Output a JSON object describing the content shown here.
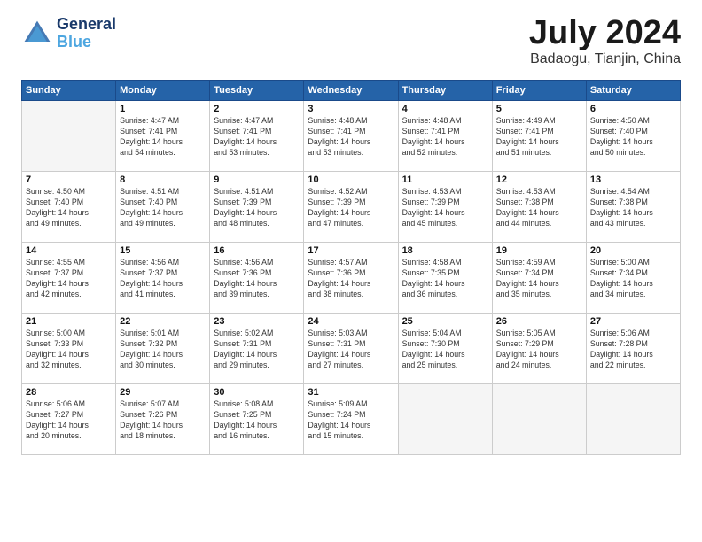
{
  "header": {
    "logo_line1": "General",
    "logo_line2": "Blue",
    "month": "July 2024",
    "location": "Badaogu, Tianjin, China"
  },
  "days": [
    "Sunday",
    "Monday",
    "Tuesday",
    "Wednesday",
    "Thursday",
    "Friday",
    "Saturday"
  ],
  "weeks": [
    [
      {
        "day": "",
        "sunrise": "",
        "sunset": "",
        "daylight": ""
      },
      {
        "day": "1",
        "sunrise": "Sunrise: 4:47 AM",
        "sunset": "Sunset: 7:41 PM",
        "daylight": "Daylight: 14 hours and 54 minutes."
      },
      {
        "day": "2",
        "sunrise": "Sunrise: 4:47 AM",
        "sunset": "Sunset: 7:41 PM",
        "daylight": "Daylight: 14 hours and 53 minutes."
      },
      {
        "day": "3",
        "sunrise": "Sunrise: 4:48 AM",
        "sunset": "Sunset: 7:41 PM",
        "daylight": "Daylight: 14 hours and 53 minutes."
      },
      {
        "day": "4",
        "sunrise": "Sunrise: 4:48 AM",
        "sunset": "Sunset: 7:41 PM",
        "daylight": "Daylight: 14 hours and 52 minutes."
      },
      {
        "day": "5",
        "sunrise": "Sunrise: 4:49 AM",
        "sunset": "Sunset: 7:41 PM",
        "daylight": "Daylight: 14 hours and 51 minutes."
      },
      {
        "day": "6",
        "sunrise": "Sunrise: 4:50 AM",
        "sunset": "Sunset: 7:40 PM",
        "daylight": "Daylight: 14 hours and 50 minutes."
      }
    ],
    [
      {
        "day": "7",
        "sunrise": "Sunrise: 4:50 AM",
        "sunset": "Sunset: 7:40 PM",
        "daylight": "Daylight: 14 hours and 49 minutes."
      },
      {
        "day": "8",
        "sunrise": "Sunrise: 4:51 AM",
        "sunset": "Sunset: 7:40 PM",
        "daylight": "Daylight: 14 hours and 49 minutes."
      },
      {
        "day": "9",
        "sunrise": "Sunrise: 4:51 AM",
        "sunset": "Sunset: 7:39 PM",
        "daylight": "Daylight: 14 hours and 48 minutes."
      },
      {
        "day": "10",
        "sunrise": "Sunrise: 4:52 AM",
        "sunset": "Sunset: 7:39 PM",
        "daylight": "Daylight: 14 hours and 47 minutes."
      },
      {
        "day": "11",
        "sunrise": "Sunrise: 4:53 AM",
        "sunset": "Sunset: 7:39 PM",
        "daylight": "Daylight: 14 hours and 45 minutes."
      },
      {
        "day": "12",
        "sunrise": "Sunrise: 4:53 AM",
        "sunset": "Sunset: 7:38 PM",
        "daylight": "Daylight: 14 hours and 44 minutes."
      },
      {
        "day": "13",
        "sunrise": "Sunrise: 4:54 AM",
        "sunset": "Sunset: 7:38 PM",
        "daylight": "Daylight: 14 hours and 43 minutes."
      }
    ],
    [
      {
        "day": "14",
        "sunrise": "Sunrise: 4:55 AM",
        "sunset": "Sunset: 7:37 PM",
        "daylight": "Daylight: 14 hours and 42 minutes."
      },
      {
        "day": "15",
        "sunrise": "Sunrise: 4:56 AM",
        "sunset": "Sunset: 7:37 PM",
        "daylight": "Daylight: 14 hours and 41 minutes."
      },
      {
        "day": "16",
        "sunrise": "Sunrise: 4:56 AM",
        "sunset": "Sunset: 7:36 PM",
        "daylight": "Daylight: 14 hours and 39 minutes."
      },
      {
        "day": "17",
        "sunrise": "Sunrise: 4:57 AM",
        "sunset": "Sunset: 7:36 PM",
        "daylight": "Daylight: 14 hours and 38 minutes."
      },
      {
        "day": "18",
        "sunrise": "Sunrise: 4:58 AM",
        "sunset": "Sunset: 7:35 PM",
        "daylight": "Daylight: 14 hours and 36 minutes."
      },
      {
        "day": "19",
        "sunrise": "Sunrise: 4:59 AM",
        "sunset": "Sunset: 7:34 PM",
        "daylight": "Daylight: 14 hours and 35 minutes."
      },
      {
        "day": "20",
        "sunrise": "Sunrise: 5:00 AM",
        "sunset": "Sunset: 7:34 PM",
        "daylight": "Daylight: 14 hours and 34 minutes."
      }
    ],
    [
      {
        "day": "21",
        "sunrise": "Sunrise: 5:00 AM",
        "sunset": "Sunset: 7:33 PM",
        "daylight": "Daylight: 14 hours and 32 minutes."
      },
      {
        "day": "22",
        "sunrise": "Sunrise: 5:01 AM",
        "sunset": "Sunset: 7:32 PM",
        "daylight": "Daylight: 14 hours and 30 minutes."
      },
      {
        "day": "23",
        "sunrise": "Sunrise: 5:02 AM",
        "sunset": "Sunset: 7:31 PM",
        "daylight": "Daylight: 14 hours and 29 minutes."
      },
      {
        "day": "24",
        "sunrise": "Sunrise: 5:03 AM",
        "sunset": "Sunset: 7:31 PM",
        "daylight": "Daylight: 14 hours and 27 minutes."
      },
      {
        "day": "25",
        "sunrise": "Sunrise: 5:04 AM",
        "sunset": "Sunset: 7:30 PM",
        "daylight": "Daylight: 14 hours and 25 minutes."
      },
      {
        "day": "26",
        "sunrise": "Sunrise: 5:05 AM",
        "sunset": "Sunset: 7:29 PM",
        "daylight": "Daylight: 14 hours and 24 minutes."
      },
      {
        "day": "27",
        "sunrise": "Sunrise: 5:06 AM",
        "sunset": "Sunset: 7:28 PM",
        "daylight": "Daylight: 14 hours and 22 minutes."
      }
    ],
    [
      {
        "day": "28",
        "sunrise": "Sunrise: 5:06 AM",
        "sunset": "Sunset: 7:27 PM",
        "daylight": "Daylight: 14 hours and 20 minutes."
      },
      {
        "day": "29",
        "sunrise": "Sunrise: 5:07 AM",
        "sunset": "Sunset: 7:26 PM",
        "daylight": "Daylight: 14 hours and 18 minutes."
      },
      {
        "day": "30",
        "sunrise": "Sunrise: 5:08 AM",
        "sunset": "Sunset: 7:25 PM",
        "daylight": "Daylight: 14 hours and 16 minutes."
      },
      {
        "day": "31",
        "sunrise": "Sunrise: 5:09 AM",
        "sunset": "Sunset: 7:24 PM",
        "daylight": "Daylight: 14 hours and 15 minutes."
      },
      {
        "day": "",
        "sunrise": "",
        "sunset": "",
        "daylight": ""
      },
      {
        "day": "",
        "sunrise": "",
        "sunset": "",
        "daylight": ""
      },
      {
        "day": "",
        "sunrise": "",
        "sunset": "",
        "daylight": ""
      }
    ]
  ]
}
